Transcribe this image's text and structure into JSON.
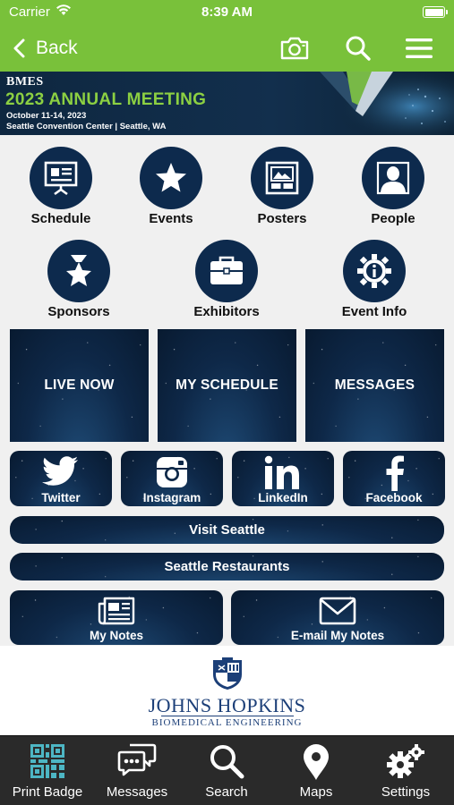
{
  "status_bar": {
    "carrier": "Carrier",
    "time": "8:39 AM"
  },
  "nav": {
    "back_label": "Back"
  },
  "banner": {
    "org": "BMES",
    "title": "2023 ANNUAL MEETING",
    "dates": "October 11-14, 2023",
    "venue": "Seattle Convention Center | Seattle, WA"
  },
  "icon_grid": {
    "row1": [
      "Schedule",
      "Events",
      "Posters",
      "People"
    ],
    "row2": [
      "Sponsors",
      "Exhibitors",
      "Event Info"
    ]
  },
  "feature_tiles": [
    "LIVE NOW",
    "MY SCHEDULE",
    "MESSAGES"
  ],
  "social": [
    "Twitter",
    "Instagram",
    "LinkedIn",
    "Facebook"
  ],
  "links": {
    "visit": "Visit Seattle",
    "restaurants": "Seattle Restaurants"
  },
  "notes": {
    "my_notes": "My Notes",
    "email_notes": "E-mail My Notes"
  },
  "sponsor": {
    "name": "JOHNS HOPKINS",
    "dept": "BIOMEDICAL ENGINEERING"
  },
  "tabs": [
    "Print Badge",
    "Messages",
    "Search",
    "Maps",
    "Settings"
  ],
  "colors": {
    "brand_green": "#79c13a",
    "navy": "#0d2a4d",
    "banner_green": "#8cd042",
    "tab_bar": "#2a2a2a",
    "qr_icon": "#4db6c4"
  }
}
